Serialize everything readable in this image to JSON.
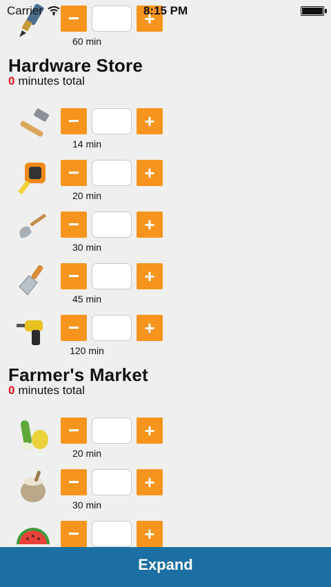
{
  "status_bar": {
    "carrier": "Carrier",
    "time": "8:15 PM"
  },
  "top_row": {
    "duration": "60 min",
    "icon": "caulk-tube-icon"
  },
  "hardware": {
    "title": "Hardware Store",
    "total_count": "0",
    "total_suffix": "minutes total",
    "items": [
      {
        "icon": "hammer-icon",
        "duration": "14 min"
      },
      {
        "icon": "tape-measure-icon",
        "duration": "20 min"
      },
      {
        "icon": "shovel-icon",
        "duration": "30 min"
      },
      {
        "icon": "putty-knife-icon",
        "duration": "45 min"
      },
      {
        "icon": "power-drill-icon",
        "duration": "120 min"
      }
    ]
  },
  "farmers": {
    "title": "Farmer's Market",
    "total_count": "0",
    "total_suffix": "minutes total",
    "items": [
      {
        "icon": "vegetables-icon",
        "duration": "20 min"
      },
      {
        "icon": "grain-sack-icon",
        "duration": "30 min"
      },
      {
        "icon": "watermelon-icon",
        "duration": ""
      }
    ]
  },
  "buttons": {
    "minus": "−",
    "plus": "+"
  },
  "footer": {
    "expand_label": "Expand"
  },
  "colors": {
    "accent": "#f7941d",
    "footer": "#1b6fa2",
    "zero": "#e0121b"
  }
}
